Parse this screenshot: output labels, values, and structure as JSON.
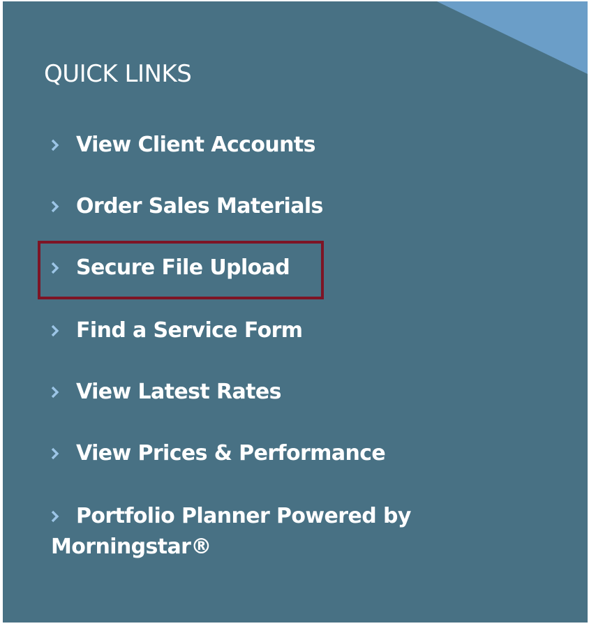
{
  "panel": {
    "background_color": "#487184",
    "corner_accent_color": "#6b9ec8",
    "chevron_color": "#9cc5e6",
    "highlight_color": "#7d1425"
  },
  "quick_links": {
    "heading": "QUICK LINKS",
    "items": [
      {
        "label": "View Client Accounts",
        "icon": "chevron-right-icon"
      },
      {
        "label": "Order Sales Materials",
        "icon": "chevron-right-icon"
      },
      {
        "label": "Secure File Upload",
        "icon": "chevron-right-icon",
        "highlighted": true
      },
      {
        "label": "Find a Service Form",
        "icon": "chevron-right-icon"
      },
      {
        "label": "View Latest Rates",
        "icon": "chevron-right-icon"
      },
      {
        "label": "View Prices & Performance",
        "icon": "chevron-right-icon"
      },
      {
        "label": "Portfolio Planner Powered by Morningstar®",
        "icon": "chevron-right-icon"
      }
    ]
  }
}
